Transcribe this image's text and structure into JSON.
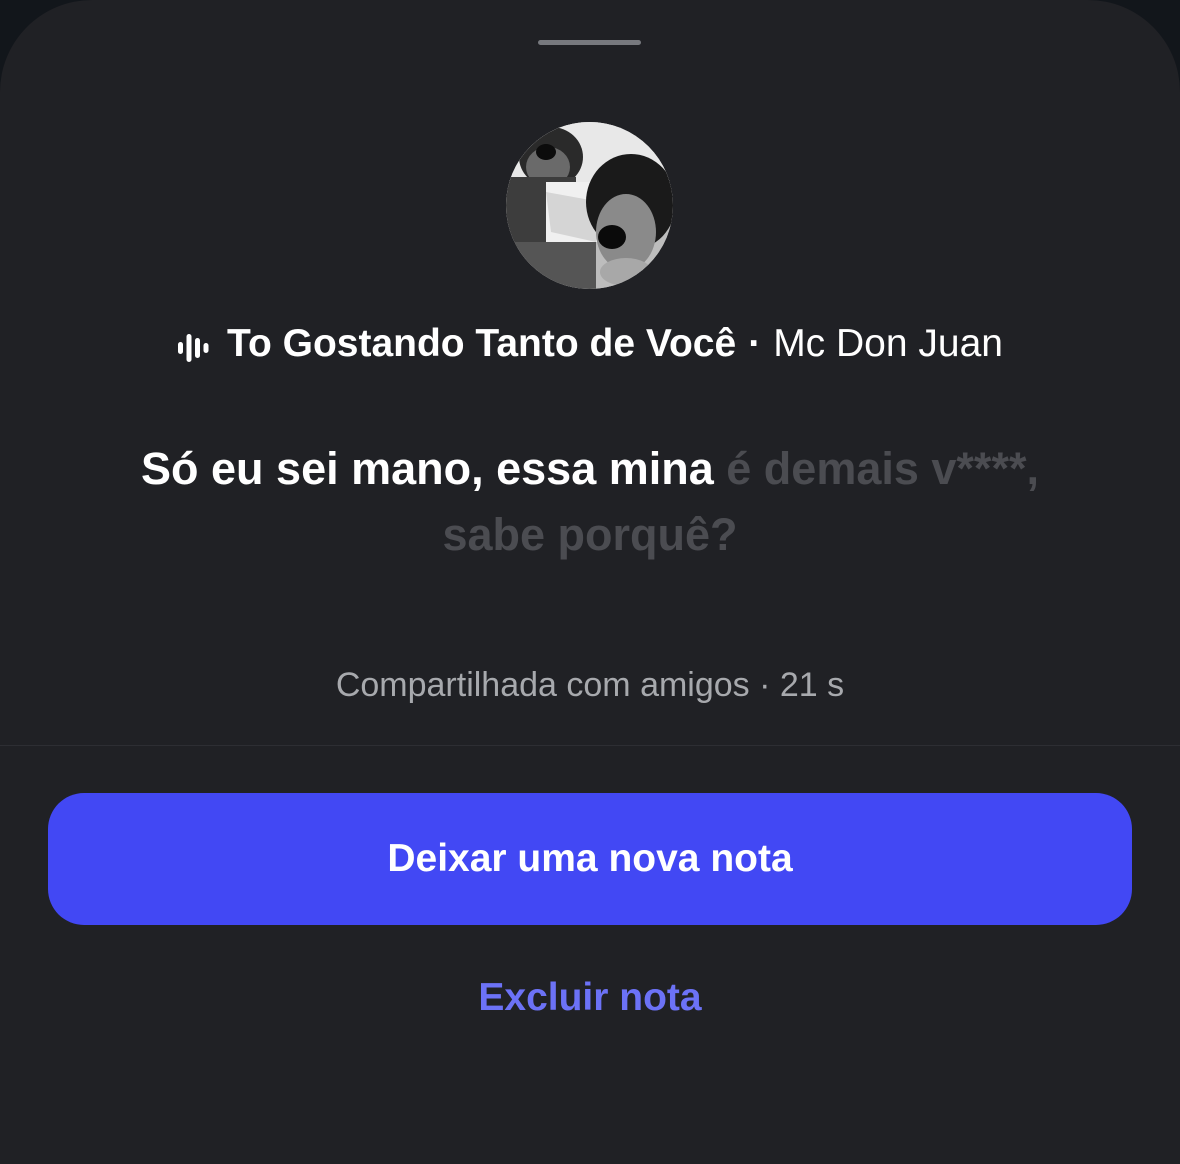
{
  "song": {
    "icon": "audio-waveform-icon",
    "title": "To Gostando Tanto de Você",
    "separator": "·",
    "artist": "Mc Don Juan"
  },
  "lyrics": {
    "highlighted": "Só eu sei mano, essa mina",
    "dimmed": "é demais v****, sabe porquê?"
  },
  "audience": {
    "shared_text": "Compartilhada com amigos · 21 s"
  },
  "actions": {
    "new_note_label": "Deixar uma nova nota",
    "delete_note_label": "Excluir nota"
  },
  "colors": {
    "sheet_background": "#202125",
    "primary_button": "#4248f4",
    "link": "#6c72f6",
    "dim_lyric": "#4b4c51"
  }
}
